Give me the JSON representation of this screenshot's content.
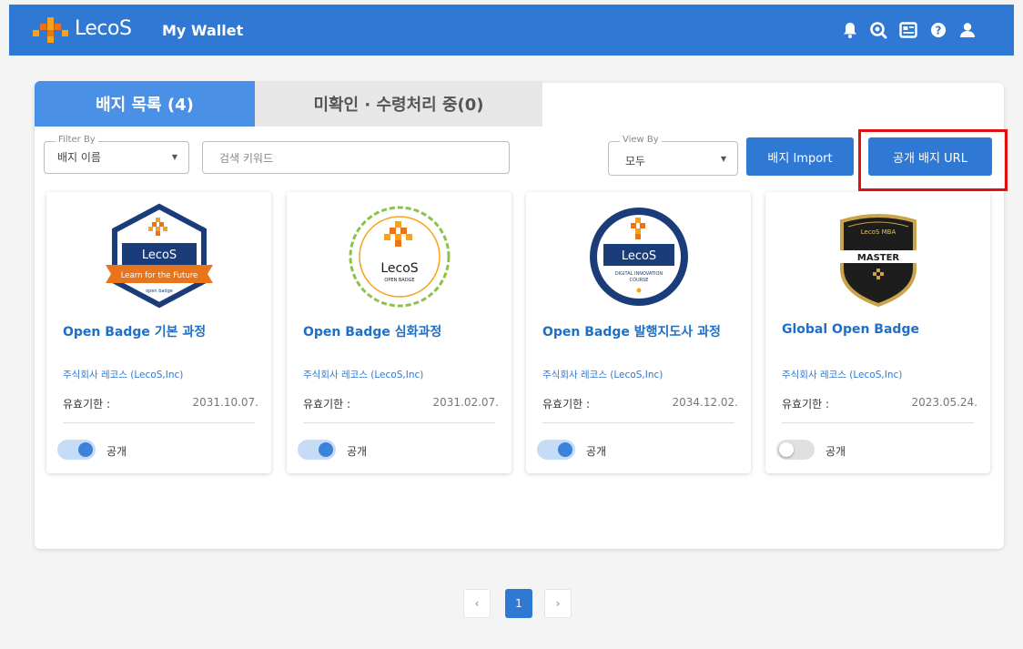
{
  "header": {
    "brand": "LecoS",
    "app_title": "My Wallet",
    "icons": [
      "bell-icon",
      "search-badge-icon",
      "id-card-icon",
      "help-icon",
      "user-icon"
    ]
  },
  "tabs": [
    {
      "label": "배지 목록 (4)",
      "active": true
    },
    {
      "label": "미확인 · 수령처리 중(0)",
      "active": false
    }
  ],
  "filter": {
    "legend": "Filter By",
    "value": "배지 이름"
  },
  "search": {
    "placeholder": "검색 키워드"
  },
  "view": {
    "legend": "View By",
    "value": "모두"
  },
  "buttons": {
    "import": "배지 Import",
    "public_url": "공개 배지 URL"
  },
  "badges": [
    {
      "name": "Open Badge 기본 과정",
      "issuer": "주식회사 레코스 (LecoS,Inc)",
      "expiry_label": "유효기한 :",
      "expiry": "2031.10.07.",
      "public_label": "공개",
      "public": true,
      "art": {
        "brand": "LecoS",
        "ribbon": "Learn for the Future",
        "small": "open badge"
      }
    },
    {
      "name": "Open Badge 심화과정",
      "issuer": "주식회사 레코스 (LecoS,Inc)",
      "expiry_label": "유효기한 :",
      "expiry": "2031.02.07.",
      "public_label": "공개",
      "public": true,
      "art": {
        "brand": "LecoS",
        "small": "OPEN BADGE"
      }
    },
    {
      "name": "Open Badge 발행지도사 과정",
      "issuer": "주식회사 레코스 (LecoS,Inc)",
      "expiry_label": "유효기한 :",
      "expiry": "2034.12.02.",
      "public_label": "공개",
      "public": true,
      "art": {
        "brand": "LecoS",
        "line1": "DIGITAL INNOVATION",
        "line2": "COURSE"
      }
    },
    {
      "name": "Global Open Badge",
      "issuer": "주식회사 레코스 (LecoS,Inc)",
      "expiry_label": "유효기한 :",
      "expiry": "2023.05.24.",
      "public_label": "공개",
      "public": false,
      "art": {
        "arc": "LecoS MBA",
        "main": "MASTER"
      }
    }
  ],
  "pagination": {
    "prev": "‹",
    "current": "1",
    "next": "›"
  },
  "colors": {
    "primary": "#2f78d3",
    "tab_active": "#4a90e6",
    "highlight": "#e01010",
    "badge_orange": "#e8741c"
  }
}
